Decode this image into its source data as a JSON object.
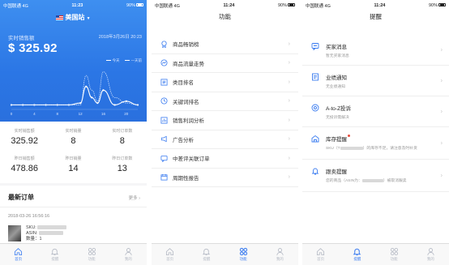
{
  "status": {
    "carrier": "中国联通 4G",
    "time1": "11:23",
    "time2": "11:24",
    "time3": "11:24",
    "battery": "90%"
  },
  "home": {
    "market": "美国站",
    "realtime_label": "实时销售额",
    "realtime_time": "2018年3月26日 20:23",
    "realtime_value": "$ 325.92",
    "legend_today": "今天",
    "legend_yesterday": "一天前",
    "x_ticks": [
      "0",
      "4",
      "8",
      "12",
      "16",
      "20"
    ],
    "stats": [
      {
        "label": "实时销售额",
        "value": "325.92"
      },
      {
        "label": "实时销量",
        "value": "8"
      },
      {
        "label": "实时订单数",
        "value": "8"
      },
      {
        "label": "昨日销售额",
        "value": "478.86"
      },
      {
        "label": "昨日销量",
        "value": "14"
      },
      {
        "label": "昨日订单数",
        "value": "13"
      }
    ],
    "orders_title": "最新订单",
    "orders_more": "更多",
    "order_date": "2018-03-26 16:56:16",
    "order_sku": "SKU:",
    "order_asin": "ASIN:",
    "order_qty": "数量：1"
  },
  "chart_data": {
    "type": "line",
    "x": [
      0,
      2,
      4,
      6,
      8,
      10,
      12,
      13,
      14,
      15,
      16,
      18,
      20,
      22
    ],
    "series": [
      {
        "name": "今天",
        "values": [
          2,
          2,
          2,
          2,
          2,
          2,
          3,
          12,
          6,
          3,
          10,
          2,
          4,
          2
        ]
      },
      {
        "name": "一天前",
        "values": [
          2,
          2,
          2,
          2,
          2,
          2,
          2,
          18,
          10,
          4,
          20,
          6,
          3,
          2
        ]
      }
    ],
    "xlabel": "",
    "ylabel": "",
    "x_ticks": [
      "0",
      "4",
      "8",
      "12",
      "16",
      "20"
    ]
  },
  "functions": {
    "title": "功能",
    "items": [
      {
        "label": "商品畅销榜",
        "icon": "medal-icon"
      },
      {
        "label": "商品流量走势",
        "icon": "trend-icon"
      },
      {
        "label": "类目排名",
        "icon": "list-icon"
      },
      {
        "label": "关键词排名",
        "icon": "search-rank-icon"
      },
      {
        "label": "销售利润分析",
        "icon": "chart-icon"
      },
      {
        "label": "广告分析",
        "icon": "megaphone-icon"
      },
      {
        "label": "中差评关联订单",
        "icon": "comment-icon"
      },
      {
        "label": "周期性报告",
        "icon": "calendar-icon"
      }
    ]
  },
  "notices": {
    "title": "提醒",
    "items": [
      {
        "title": "买家消息",
        "sub": "暂无买家消息"
      },
      {
        "title": "业绩通知",
        "sub": "无业绩通知"
      },
      {
        "title": "A-to-Z投诉",
        "sub": "无投诉需解决"
      },
      {
        "title": "库存提醒",
        "sub_a": "SKU（T",
        "sub_b": "）的库存不足，请注意及时补货"
      },
      {
        "title": "跟卖提醒",
        "sub_a": "您的商品（ASIN为：",
        "sub_b": "）被取消跟卖"
      }
    ]
  },
  "tabs": [
    {
      "label": "首页",
      "icon": "home-icon"
    },
    {
      "label": "提醒",
      "icon": "bell-icon"
    },
    {
      "label": "功能",
      "icon": "grid-icon"
    },
    {
      "label": "我的",
      "icon": "user-icon"
    }
  ],
  "colors": {
    "accent": "#3b7cf0",
    "hero_top": "#3e8ff0",
    "hero_bottom": "#2a70de",
    "tab_inactive": "#b4b9c4"
  }
}
